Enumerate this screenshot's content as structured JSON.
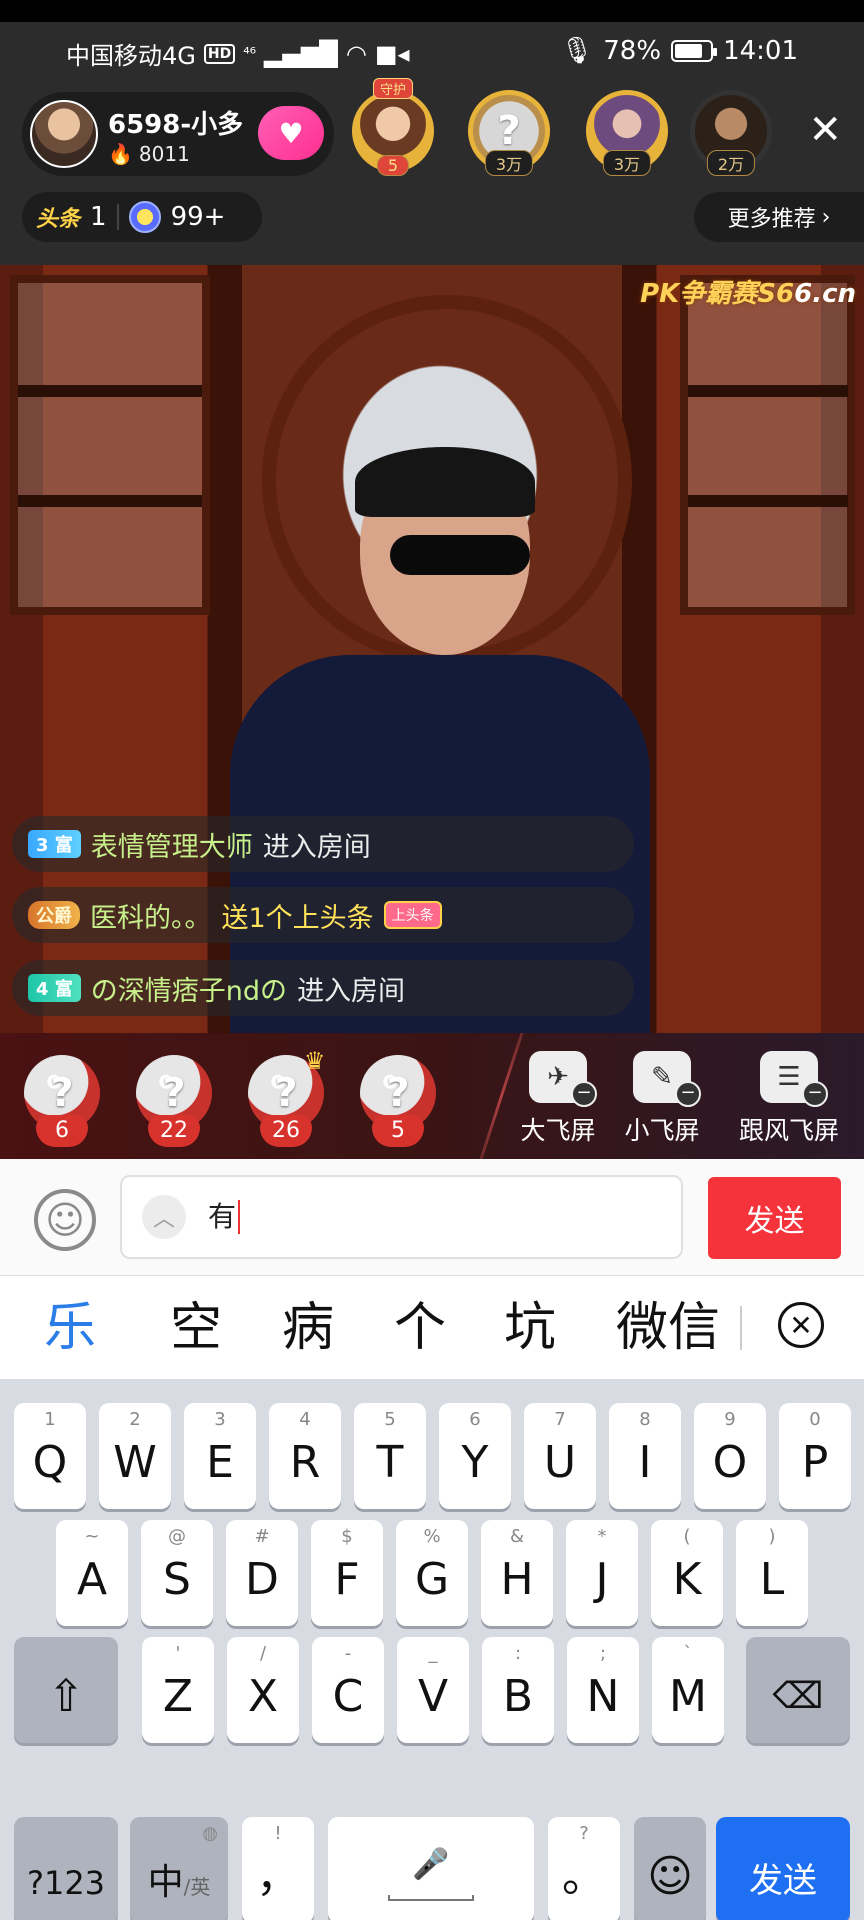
{
  "status_bar": {
    "carrier": "中国移动4G",
    "hd": "HD",
    "network": "⁴⁶",
    "battery_pct": "78%",
    "battery_level": 0.78,
    "time": "14:01"
  },
  "anchor": {
    "name": "6598-小多",
    "heat": "8011",
    "follow_icon": "heart-hands-icon"
  },
  "viewers": [
    {
      "badge": "5",
      "crown": "守护"
    },
    {
      "badge": "3万"
    },
    {
      "badge": "3万"
    },
    {
      "badge": "2万"
    }
  ],
  "header_stats": {
    "toutiao_label": "头条",
    "toutiao_count": "1",
    "stars_count": "99+",
    "more_recommend": "更多推荐"
  },
  "video": {
    "watermark_prefix": "PK争霸赛S6",
    "watermark_site": "6.cn"
  },
  "chat": [
    {
      "level": "3 富",
      "user": "表情管理大师",
      "text": "进入房间"
    },
    {
      "level": "公爵",
      "user": "医科的。。",
      "text": "送1个上头条",
      "gift": "上头条"
    },
    {
      "level": "4 富",
      "user": "の深情痞子ndの",
      "text": "进入房间"
    }
  ],
  "fly_gifts": [
    {
      "count": "6"
    },
    {
      "count": "22"
    },
    {
      "count": "26"
    },
    {
      "count": "5"
    }
  ],
  "fly_buttons": [
    {
      "label": "大飞屏"
    },
    {
      "label": "小飞屏"
    },
    {
      "label": "跟风飞屏"
    }
  ],
  "input": {
    "value": "有",
    "send": "发送"
  },
  "candidates": [
    "乐",
    "空",
    "病",
    "个",
    "坑",
    "微信"
  ],
  "keyboard": {
    "row1": [
      {
        "k": "Q",
        "s": "1"
      },
      {
        "k": "W",
        "s": "2"
      },
      {
        "k": "E",
        "s": "3"
      },
      {
        "k": "R",
        "s": "4"
      },
      {
        "k": "T",
        "s": "5"
      },
      {
        "k": "Y",
        "s": "6"
      },
      {
        "k": "U",
        "s": "7"
      },
      {
        "k": "I",
        "s": "8"
      },
      {
        "k": "O",
        "s": "9"
      },
      {
        "k": "P",
        "s": "0"
      }
    ],
    "row2": [
      {
        "k": "A",
        "s": "~"
      },
      {
        "k": "S",
        "s": "@"
      },
      {
        "k": "D",
        "s": "#"
      },
      {
        "k": "F",
        "s": "$"
      },
      {
        "k": "G",
        "s": "%"
      },
      {
        "k": "H",
        "s": "&"
      },
      {
        "k": "J",
        "s": "*"
      },
      {
        "k": "K",
        "s": "("
      },
      {
        "k": "L",
        "s": ")"
      }
    ],
    "row3": [
      {
        "k": "Z",
        "s": "'"
      },
      {
        "k": "X",
        "s": "/"
      },
      {
        "k": "C",
        "s": "-"
      },
      {
        "k": "V",
        "s": "_"
      },
      {
        "k": "B",
        "s": ":"
      },
      {
        "k": "N",
        "s": ";"
      },
      {
        "k": "M",
        "s": "`"
      }
    ],
    "numbers_key": "?123",
    "lang_key": "中",
    "lang_sub": "/英",
    "comma_key": "，",
    "comma_sub": "!",
    "period_key": "。",
    "period_sub": "?",
    "send_key": "发送"
  }
}
